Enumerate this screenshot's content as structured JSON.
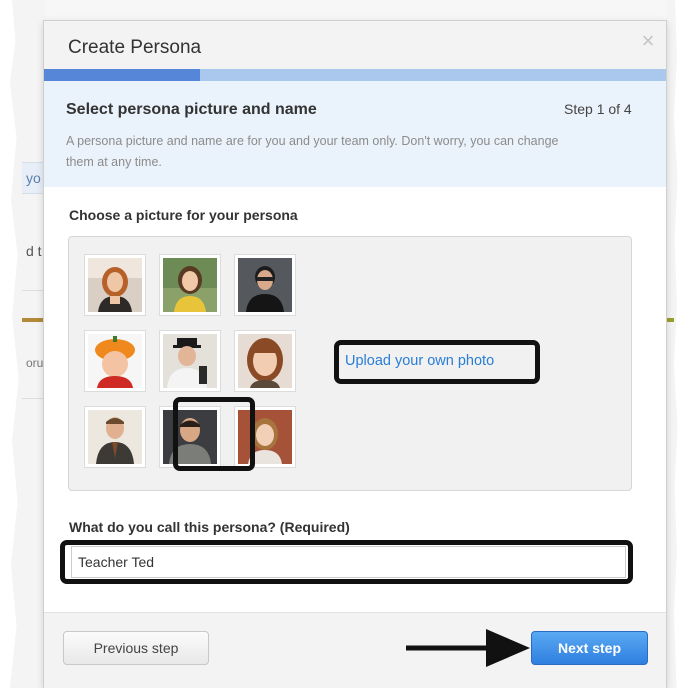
{
  "background": {
    "frag_1": "yo",
    "frag_2": "d t",
    "frag_3": "oru"
  },
  "modal": {
    "title": "Create Persona",
    "close_glyph": "×",
    "progress": {
      "step": 1,
      "total": 4,
      "fraction": 0.25
    },
    "step_title": "Select persona picture and name",
    "step_counter": "Step 1 of 4",
    "step_description": "A persona picture and name are for you and your team only. Don't worry, you can change them at any time."
  },
  "picture_section": {
    "label": "Choose a picture for your persona",
    "upload_link": "Upload your own photo",
    "selected_index": 7,
    "photo_count": 9
  },
  "name_section": {
    "label": "What do you call this persona? (Required)",
    "value": "Teacher Ted"
  },
  "footer": {
    "previous_label": "Previous step",
    "next_label": "Next step"
  },
  "colors": {
    "progress_fill": "#5586d8",
    "progress_track": "#aac7ee",
    "link": "#2a7dd6",
    "primary_button": "#2f7fe0",
    "annotation": "#111111"
  }
}
